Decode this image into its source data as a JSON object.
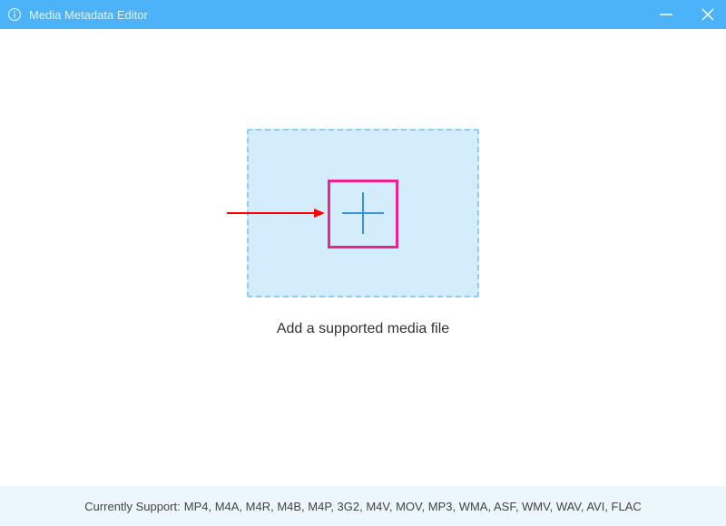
{
  "titlebar": {
    "title": "Media Metadata Editor"
  },
  "main": {
    "instruction": "Add a supported media file"
  },
  "footer": {
    "label": "Currently Support:",
    "formats": "MP4, M4A, M4R, M4B, M4P, 3G2, M4V, MOV, MP3, WMA, ASF, WMV, WAV, AVI, FLAC"
  },
  "icons": {
    "info": "info-icon",
    "minimize": "minimize-icon",
    "close": "close-icon",
    "plus": "plus-icon",
    "arrow": "arrow-annotation"
  }
}
